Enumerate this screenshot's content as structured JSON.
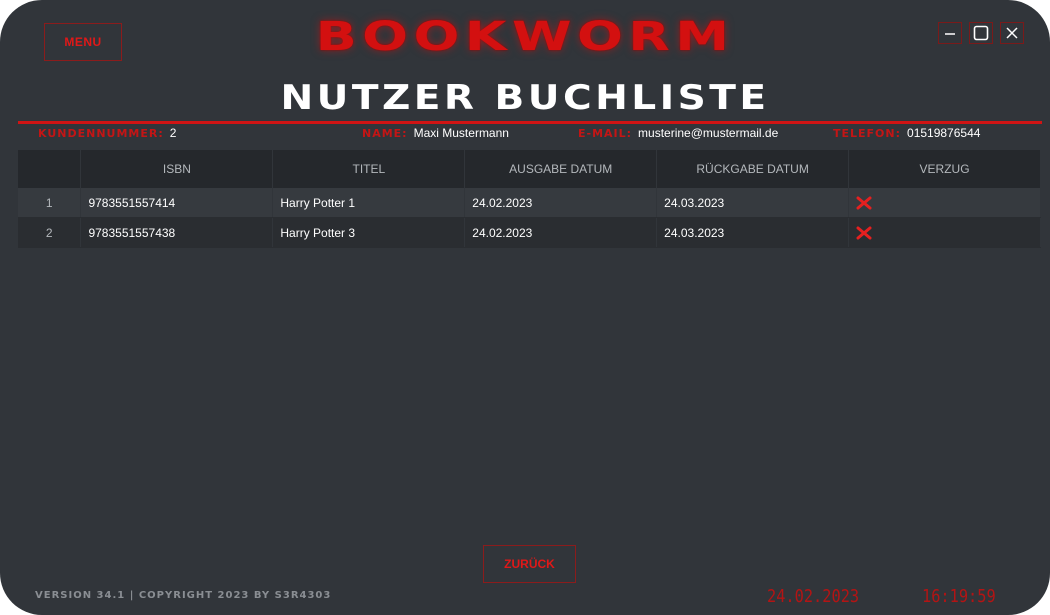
{
  "header": {
    "menu_label": "MENU",
    "app_title": "BOOKWORM",
    "page_title": "NUTZER BUCHLISTE",
    "window_controls": [
      "minimize-icon",
      "maximize-icon",
      "close-icon"
    ]
  },
  "customer": {
    "number_label": "KUNDENNUMMER:",
    "number": "2",
    "name_label": "NAME:",
    "name": "Maxi Mustermann",
    "email_label": "E-MAIL:",
    "email": "musterine@mustermail.de",
    "phone_label": "TELEFON:",
    "phone": "01519876544"
  },
  "table": {
    "columns": [
      "",
      "ISBN",
      "TITEL",
      "AUSGABE DATUM",
      "RÜCKGABE DATUM",
      "VERZUG"
    ],
    "rows": [
      {
        "index": "1",
        "isbn": "9783551557414",
        "title": "Harry Potter 1",
        "issue_date": "24.02.2023",
        "return_date": "24.03.2023",
        "overdue": "x-mark-icon"
      },
      {
        "index": "2",
        "isbn": "9783551557438",
        "title": "Harry Potter 3",
        "issue_date": "24.02.2023",
        "return_date": "24.03.2023",
        "overdue": "x-mark-icon"
      }
    ]
  },
  "footer": {
    "back_label": "ZURÜCK",
    "version": "VERSION 34.1 | COPYRIGHT 2023 BY S3R4303",
    "date": "24.02.2023",
    "time": "16:19:59"
  },
  "colors": {
    "accent": "#d31010",
    "background": "#31353a",
    "table_header": "#25282c"
  }
}
